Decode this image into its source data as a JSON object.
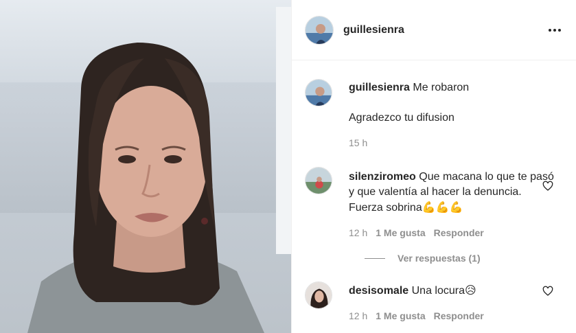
{
  "post": {
    "username": "guillesienra"
  },
  "caption": {
    "username": "guillesienra",
    "line1": "Me robaron",
    "line2": "Agradezco tu difusion",
    "time": "15 h"
  },
  "comments": [
    {
      "username": "silenziromeo",
      "text": "Que macana lo que te pasó y que valentía al hacer la denuncia. Fuerza sobrina",
      "emoji": "💪💪💪",
      "time": "12 h",
      "likes": "1 Me gusta",
      "reply": "Responder",
      "view_replies": "Ver respuestas (1)"
    },
    {
      "username": "desisomale",
      "text": "Una locura",
      "emoji": "😥",
      "time": "12 h",
      "likes": "1 Me gusta",
      "reply": "Responder"
    }
  ],
  "icons": {
    "more": "more-horizontal-icon",
    "heart": "heart-outline-icon"
  },
  "colors": {
    "text": "#262626",
    "secondary": "#8e8e8e",
    "border": "#efefef"
  }
}
